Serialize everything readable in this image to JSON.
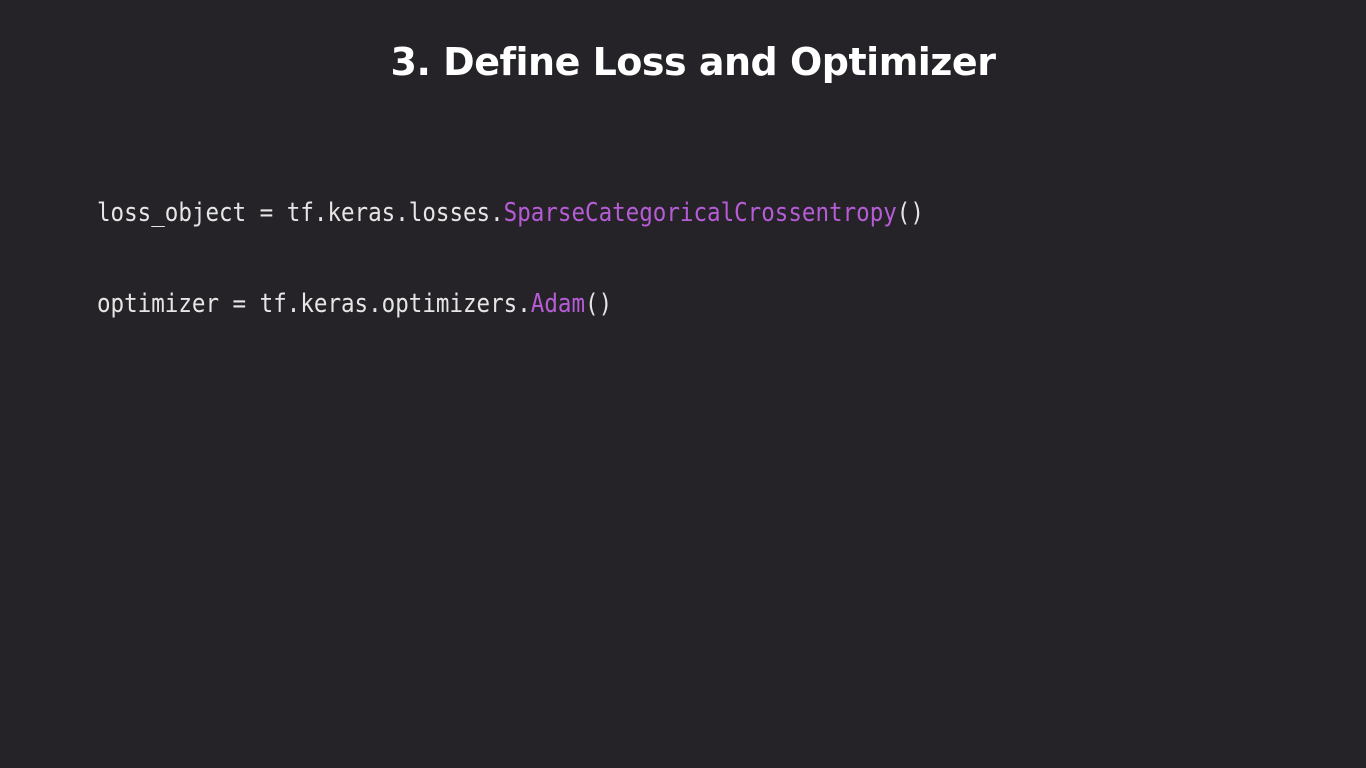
{
  "slide": {
    "title": "3. Define Loss and Optimizer"
  },
  "code": {
    "lines": [
      {
        "prefix": "loss_object = tf.keras.losses.",
        "call": "SparseCategoricalCrossentropy",
        "suffix": "()"
      },
      {
        "prefix": "optimizer = tf.keras.optimizers.",
        "call": "Adam",
        "suffix": "()"
      }
    ]
  },
  "colors": {
    "background": "#252327",
    "title": "#ffffff",
    "code_text": "#e6e6e6",
    "code_call_highlight": "#b55cd6"
  }
}
